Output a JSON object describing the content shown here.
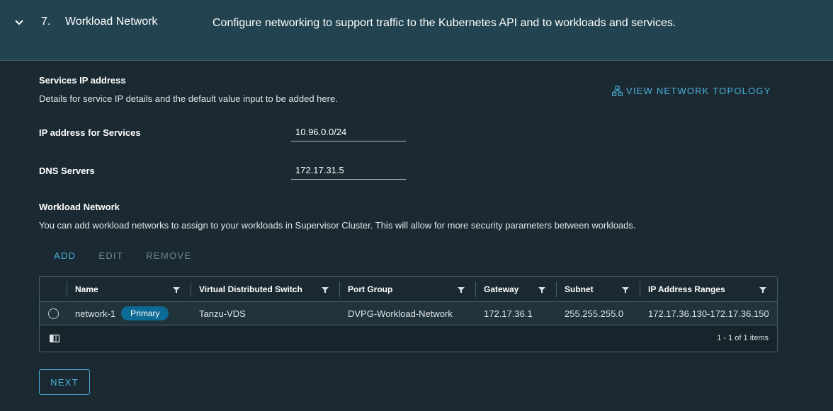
{
  "step": {
    "number": "7.",
    "title": "Workload Network",
    "description": "Configure networking to support traffic to the Kubernetes API and to workloads and services."
  },
  "services": {
    "title": "Services IP address",
    "description": "Details for service IP details and the default value input to be added here.",
    "topology_link": "VIEW NETWORK TOPOLOGY",
    "ip_label": "IP address for Services",
    "ip_value": "10.96.0.0/24",
    "dns_label": "DNS Servers",
    "dns_value": "172.17.31.5"
  },
  "workload": {
    "title": "Workload Network",
    "description": "You can add workload networks to assign to your workloads in Supervisor Cluster. This will allow for more security parameters between workloads.",
    "actions": {
      "add": "ADD",
      "edit": "EDIT",
      "remove": "REMOVE"
    },
    "columns": [
      "Name",
      "Virtual Distributed Switch",
      "Port Group",
      "Gateway",
      "Subnet",
      "IP Address Ranges"
    ],
    "rows": [
      {
        "name": "network-1",
        "badge": "Primary",
        "vds": "Tanzu-VDS",
        "port_group": "DVPG-Workload-Network",
        "gateway": "172.17.36.1",
        "subnet": "255.255.255.0",
        "ip_ranges": "172.17.36.130-172.17.36.150"
      }
    ],
    "pagination": "1 - 1 of 1 items"
  },
  "next_label": "NEXT",
  "colors": {
    "accent": "#49afd9",
    "header_bg": "#22434f",
    "body_bg": "#1b2a32",
    "badge_bg": "#0d6a94"
  }
}
